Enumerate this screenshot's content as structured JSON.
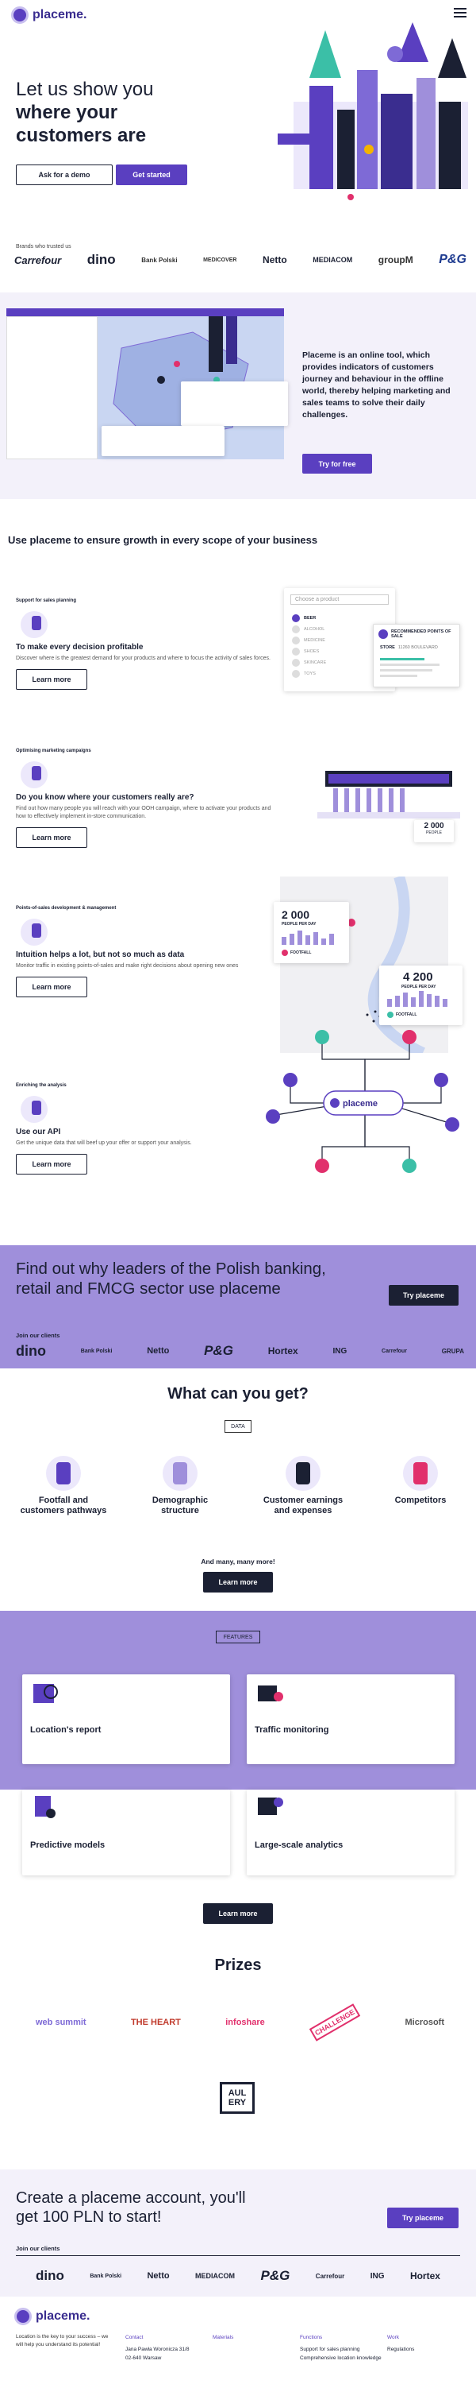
{
  "header": {
    "brand": "placeme."
  },
  "hero": {
    "line1": "Let us show you",
    "line2": "where your",
    "line3": "customers are",
    "demo_btn": "Ask for a demo",
    "start_btn": "Get started"
  },
  "brands": {
    "label": "Brands who trusted us",
    "items": [
      "Carrefour",
      "dino",
      "Bank Polski",
      "MEDICOVER",
      "Netto",
      "MEDIACOM",
      "groupM",
      "P&G"
    ]
  },
  "intro": {
    "text": "Placeme is an online tool, which provides indicators of customers journey and behaviour in the offline world, thereby helping marketing and sales teams to solve their daily challenges.",
    "try_btn": "Try for free"
  },
  "growth": {
    "title": "Use placeme to ensure growth in every scope of your business"
  },
  "sections": [
    {
      "tag": "Support for sales planning",
      "title": "To make every decision profitable",
      "text": "Discover where is the greatest demand for your products and where to focus the activity of sales forces.",
      "btn": "Learn more"
    },
    {
      "tag": "Optimising marketing campaigns",
      "title": "Do you know where your customers really are?",
      "text": "Find out how many people you will reach with your OOH campaign, where to activate your products and how to effectively implement in-store communication.",
      "btn": "Learn more"
    },
    {
      "tag": "Points-of-sales development & management",
      "title": "Intuition helps a lot, but not so much as data",
      "text": "Monitor traffic in existing points-of-sales and make right decisions about opening new ones",
      "btn": "Learn more"
    },
    {
      "tag": "Enriching the analysis",
      "title": "Use our API",
      "text": "Get the unique data that will beef up your offer or support your analysis.",
      "btn": "Learn more"
    }
  ],
  "mock1": {
    "choose": "Choose a product",
    "items": [
      "BEER",
      "ALCOHOL",
      "MEDICINE",
      "SHOES",
      "SKINCARE",
      "TOYS"
    ],
    "rec": "RECOMMENDED POINTS OF SALE",
    "store": "STORE",
    "num": "11260 BOULEVARD"
  },
  "mock2": {
    "count": "2 000",
    "unit": "PEOPLE"
  },
  "mock3": {
    "a_val": "2 000",
    "a_unit": "PEOPLE PER DAY",
    "a_tag": "FOOTFALL",
    "b_val": "4 200",
    "b_unit": "PEOPLE PER DAY",
    "b_tag": "FOOTFALL"
  },
  "mock4": {
    "brand": "placeme"
  },
  "leaders": {
    "title": "Find out why leaders of the Polish banking, retail and FMCG sector use placeme",
    "btn": "Try placeme",
    "clients_label": "Join our clients",
    "clients": [
      "dino",
      "Bank Polski",
      "Netto",
      "P&G",
      "Hortex",
      "ING",
      "Carrefour",
      "GRUPA"
    ]
  },
  "get": {
    "title": "What can you get?",
    "badge": "DATA",
    "items": [
      "Footfall and customers pathways",
      "Demographic structure",
      "Customer earnings and expenses",
      "Competitors"
    ],
    "more": "And many, many more!",
    "btn": "Learn more"
  },
  "features": {
    "badge": "FEATURES",
    "cards": [
      "Location's report",
      "Traffic monitoring",
      "Predictive models",
      "Large-scale analytics"
    ],
    "btn": "Learn more"
  },
  "prizes": {
    "title": "Prizes",
    "items": [
      "web summit",
      "THE HEART",
      "infoshare",
      "CHALLENGE",
      "Microsoft",
      "AUL ERY"
    ]
  },
  "create": {
    "title": "Create a placeme account, you'll get 100 PLN to start!",
    "btn": "Try placeme",
    "clients_label": "Join our clients",
    "clients": [
      "dino",
      "Bank Polski",
      "Netto",
      "MEDIACOM",
      "P&G",
      "Carrefour",
      "ING",
      "Hortex"
    ]
  },
  "footer": {
    "brand": "placeme.",
    "about": "Location is the key to your success – we will help you understand its potential!",
    "cols": [
      {
        "title": "Contact",
        "lines": [
          "Jana Pawła Woronicza 31/8",
          "02-640 Warsaw"
        ]
      },
      {
        "title": "Materials",
        "lines": []
      },
      {
        "title": "Functions",
        "lines": [
          "Support for sales planning",
          "Comprehensive location knowledge"
        ]
      },
      {
        "title": "Work",
        "lines": [
          "Regulations"
        ]
      }
    ]
  },
  "colors": {
    "purple": "#5a3fc0",
    "lavender": "#9f8fdb",
    "navy": "#1b2033"
  }
}
